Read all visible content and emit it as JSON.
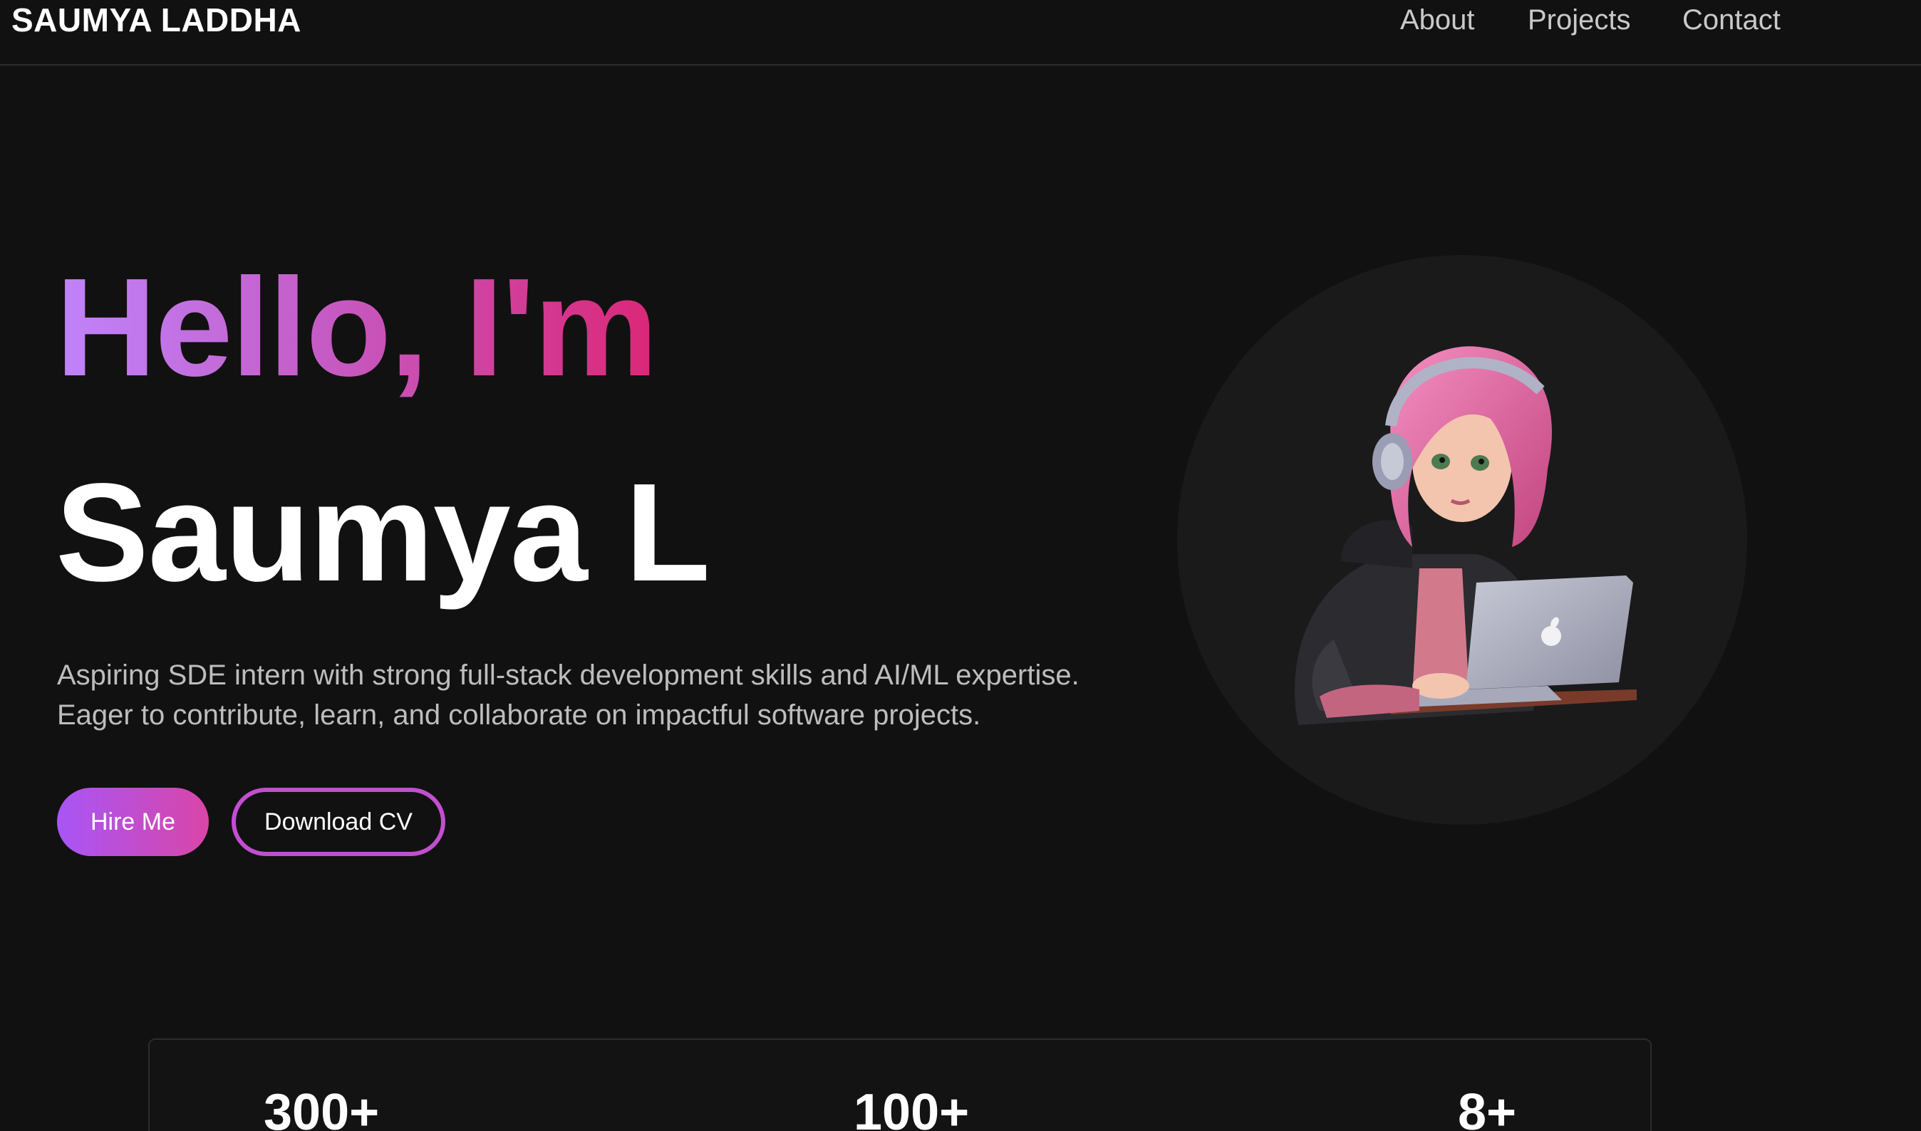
{
  "header": {
    "brand": "SAUMYA LADDHA",
    "nav": [
      {
        "label": "About"
      },
      {
        "label": "Projects"
      },
      {
        "label": "Contact"
      }
    ]
  },
  "hero": {
    "greeting": "Hello, I'm",
    "name": "Saumya L",
    "description": [
      "Aspiring SDE intern with strong full-stack development skills and AI/ML expertise.",
      "Eager to contribute, learn, and collaborate on impactful software projects."
    ],
    "buttons": {
      "hire": "Hire Me",
      "cv": "Download CV"
    },
    "avatar_icon": "girl-with-laptop-illustration"
  },
  "stats": [
    {
      "value": "300+"
    },
    {
      "value": "100+"
    },
    {
      "value": "8+"
    }
  ],
  "colors": {
    "background": "#111111",
    "accent_purple": "#a855f7",
    "accent_pink": "#db2777",
    "muted_text": "#bdbdbd"
  }
}
